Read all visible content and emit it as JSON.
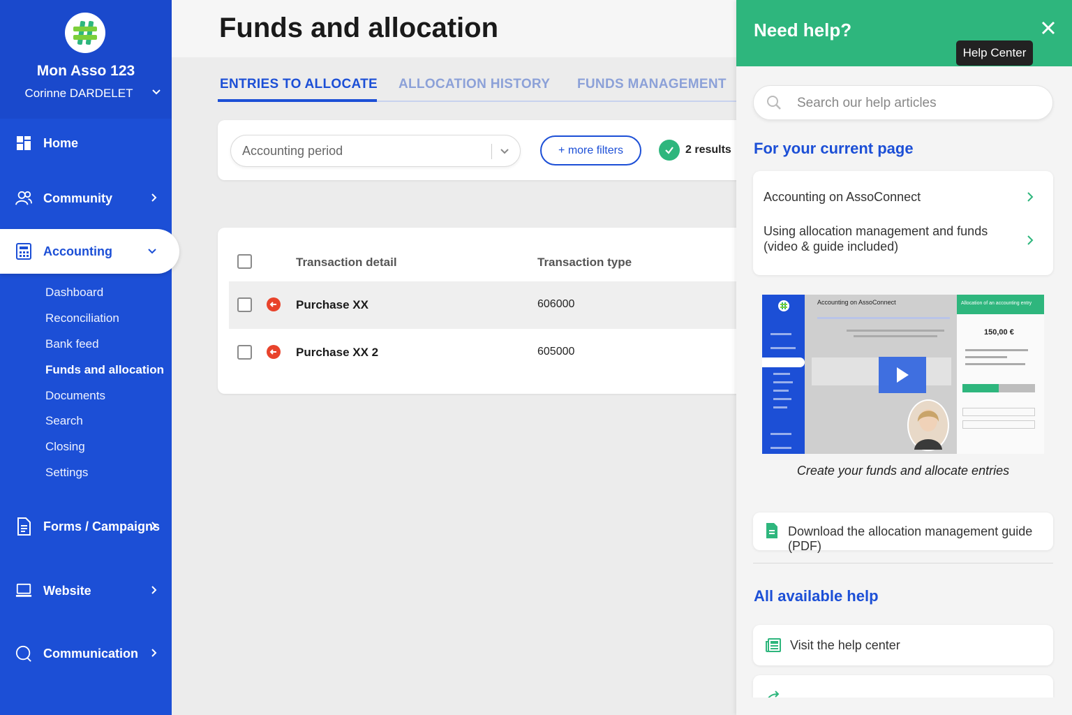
{
  "sidebar": {
    "org_name": "Mon Asso 123",
    "user_name": "Corinne DARDELET",
    "items": [
      {
        "label": "Home"
      },
      {
        "label": "Community"
      },
      {
        "label": "Accounting"
      },
      {
        "label": "Forms / Campaigns"
      },
      {
        "label": "Website"
      },
      {
        "label": "Communication"
      }
    ],
    "accounting_subitems": [
      {
        "label": "Dashboard"
      },
      {
        "label": "Reconciliation"
      },
      {
        "label": "Bank feed"
      },
      {
        "label": "Funds and allocation"
      },
      {
        "label": "Documents"
      },
      {
        "label": "Search"
      },
      {
        "label": "Closing"
      },
      {
        "label": "Settings"
      }
    ]
  },
  "main": {
    "title": "Funds and allocation",
    "tabs": [
      {
        "label": "ENTRIES TO ALLOCATE"
      },
      {
        "label": "ALLOCATION HISTORY"
      },
      {
        "label": "FUNDS MANAGEMENT"
      }
    ],
    "filters": {
      "period_placeholder": "Accounting period",
      "more_filters": "+ more filters",
      "results": "2 results"
    },
    "table": {
      "headers": [
        "Transaction detail",
        "Transaction type"
      ],
      "rows": [
        {
          "detail": "Purchase XX",
          "type": "606000"
        },
        {
          "detail": "Purchase XX 2",
          "type": "605000"
        }
      ]
    }
  },
  "help": {
    "title": "Need help?",
    "tooltip": "Help Center",
    "search_placeholder": "Search our help articles",
    "current_page_title": "For your current page",
    "articles": [
      {
        "label": "Accounting on AssoConnect"
      },
      {
        "label": "Using allocation management and funds (video & guide included)"
      }
    ],
    "video": {
      "inner_title": "Accounting on AssoConnect",
      "inner_panel_title": "Allocation of an accounting entry",
      "inner_amount": "150,00 €",
      "caption": "Create your funds and allocate entries"
    },
    "download_label": "Download the allocation management guide (PDF)",
    "all_help_title": "All available help",
    "visit_label": "Visit the help center"
  },
  "colors": {
    "brand_blue": "#1c4fd6",
    "help_green": "#2eb67d",
    "alert_red": "#e8432b"
  }
}
